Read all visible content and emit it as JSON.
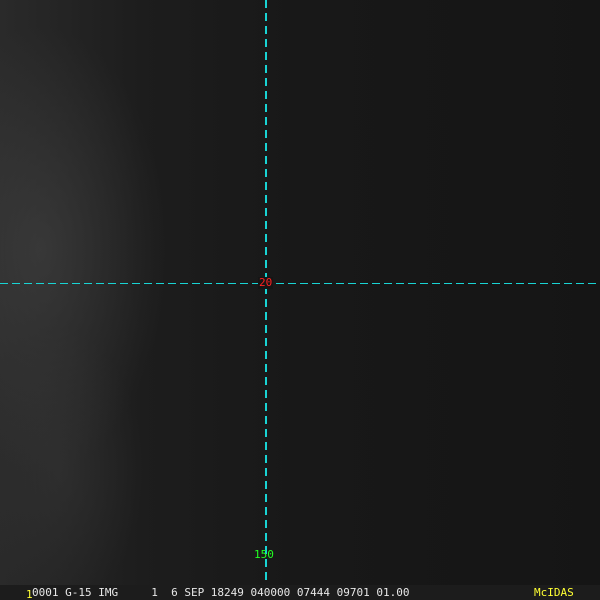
{
  "display": {
    "app": "McIDAS",
    "frame_number": "1",
    "status_line": "0001 G-15 IMG     1  6 SEP 18249 040000 07444 09701 01.00",
    "crosshair": {
      "latitude_label": "20",
      "longitude_label": "150",
      "line_color": "#19d4d4"
    },
    "colors": {
      "latitude_label": "#ff2020",
      "longitude_label": "#22ff22",
      "frame_and_brand": "#ffff33"
    }
  }
}
